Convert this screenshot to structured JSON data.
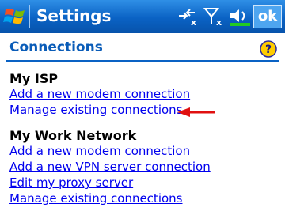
{
  "titlebar": {
    "title": "Settings",
    "ok_label": "ok"
  },
  "header": {
    "title": "Connections"
  },
  "groups": [
    {
      "heading": "My ISP",
      "links": [
        "Add a new modem connection",
        "Manage existing connections"
      ]
    },
    {
      "heading": "My Work Network",
      "links": [
        "Add a new modem connection",
        "Add a new VPN server connection",
        "Edit my proxy server",
        "Manage existing connections"
      ]
    }
  ],
  "icons": {
    "start": "windows-flag-icon",
    "connectivity": "connectivity-icon",
    "signal": "signal-off-icon",
    "volume": "volume-icon",
    "help": "help-icon",
    "annotation": "red-arrow-icon"
  },
  "colors": {
    "titlebar": "#0a62c4",
    "header_text": "#0a5cb8",
    "link": "#0000ee",
    "arrow": "#e01010"
  }
}
